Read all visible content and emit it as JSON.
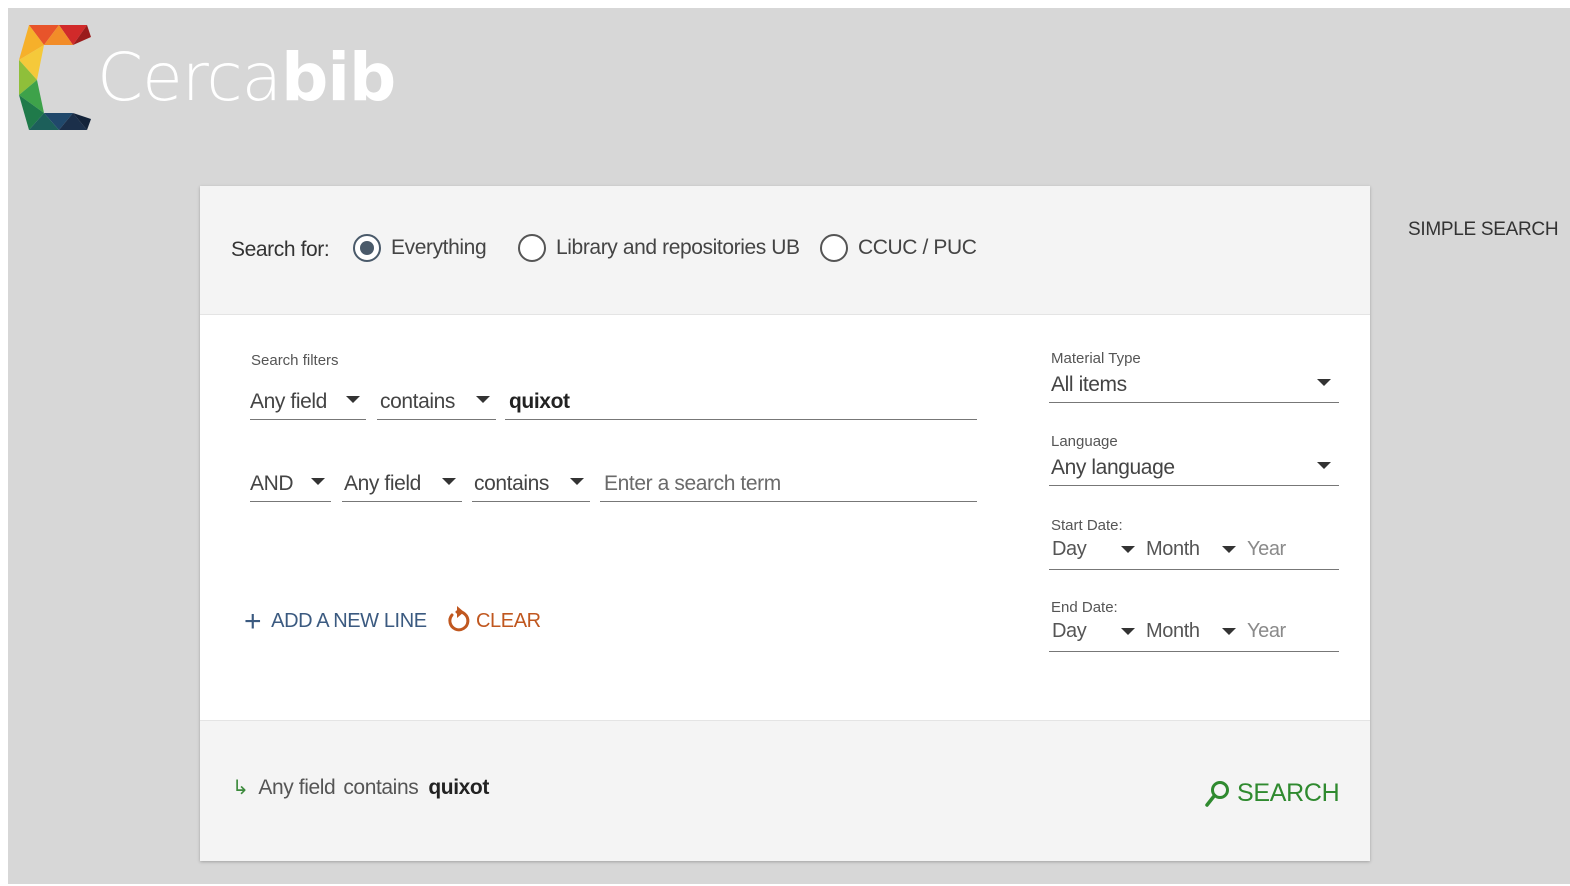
{
  "header": {
    "logo_light": "Cerca",
    "logo_bold": "bib",
    "simple_search_link": "SIMPLE SEARCH"
  },
  "scope": {
    "label": "Search for:",
    "options": [
      {
        "label": "Everything",
        "selected": true
      },
      {
        "label": "Library and repositories UB",
        "selected": false
      },
      {
        "label": "CCUC / PUC",
        "selected": false
      }
    ]
  },
  "filters": {
    "title": "Search filters",
    "row1": {
      "field": "Any field",
      "operator": "contains",
      "term": "quixot"
    },
    "row2": {
      "boolean": "AND",
      "field": "Any field",
      "operator": "contains",
      "placeholder": "Enter a search term"
    },
    "add_line_label": "ADD A NEW LINE",
    "clear_label": "CLEAR"
  },
  "sidebar": {
    "material_type": {
      "label": "Material Type",
      "value": "All items"
    },
    "language": {
      "label": "Language",
      "value": "Any language"
    },
    "start_date": {
      "label": "Start Date:",
      "day": "Day",
      "month": "Month",
      "year": "Year"
    },
    "end_date": {
      "label": "End Date:",
      "day": "Day",
      "month": "Month",
      "year": "Year"
    }
  },
  "summary": {
    "field": "Any field",
    "operator": "contains",
    "term": "quixot"
  },
  "search_button": "SEARCH",
  "colors": {
    "background": "#d7d7d7",
    "accent_blue": "#3b5a80",
    "clear_orange": "#c0571f",
    "search_green": "#2f8a2f"
  }
}
